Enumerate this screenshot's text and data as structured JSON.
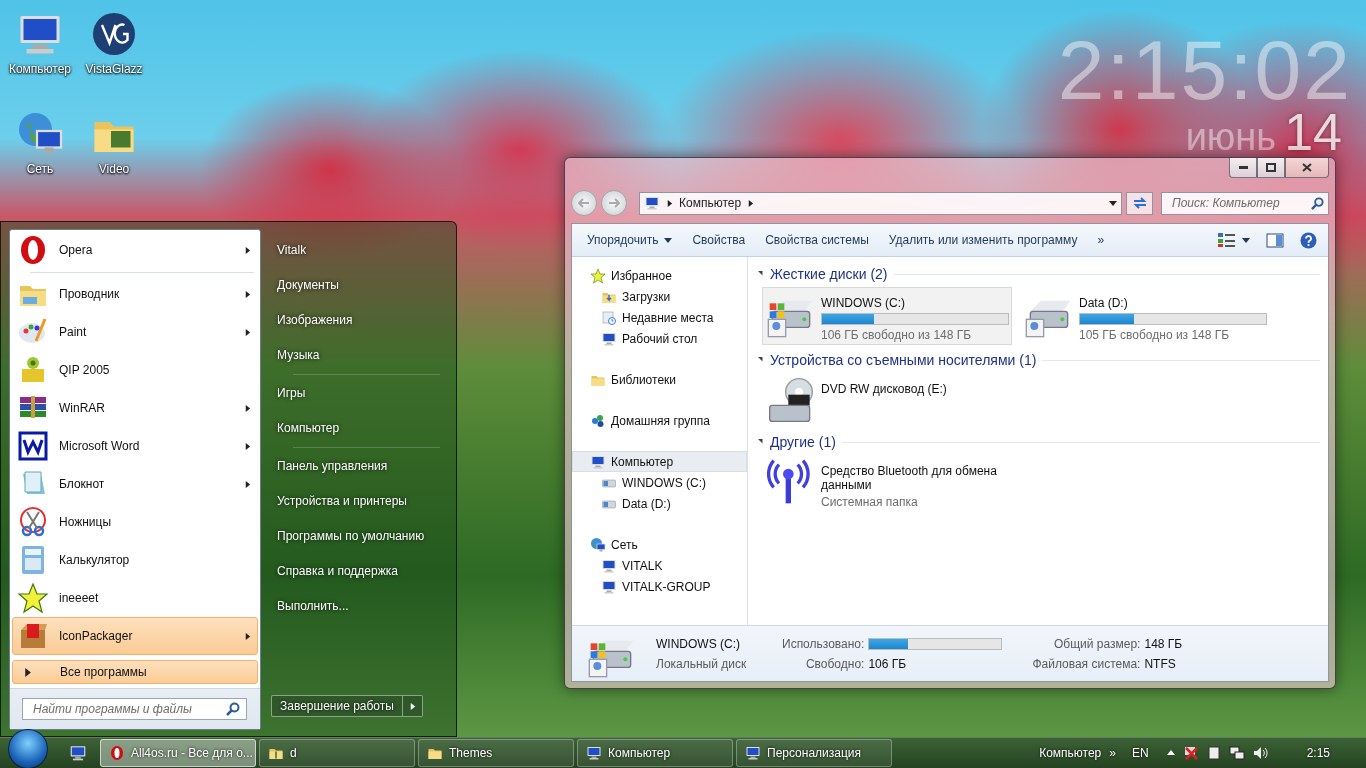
{
  "desktop_icons": [
    {
      "label": "Компьютер",
      "kind": "computer"
    },
    {
      "label": "VistaGlazz",
      "kind": "vg"
    },
    {
      "label": "Сеть",
      "kind": "network"
    },
    {
      "label": "Video",
      "kind": "video"
    }
  ],
  "clock_gadget": {
    "time": "2:15:02",
    "month": "июнь",
    "day": "14"
  },
  "start_menu": {
    "pinned": [
      {
        "label": "Opera",
        "kind": "opera",
        "submenu": true,
        "selected": false
      }
    ],
    "recent": [
      {
        "label": "Проводник",
        "kind": "explorer",
        "submenu": true,
        "selected": false
      },
      {
        "label": "Paint",
        "kind": "paint",
        "submenu": true,
        "selected": false
      },
      {
        "label": "QIP 2005",
        "kind": "qip",
        "submenu": false,
        "selected": false
      },
      {
        "label": "WinRAR",
        "kind": "winrar",
        "submenu": true,
        "selected": false
      },
      {
        "label": "Microsoft Word",
        "kind": "word",
        "submenu": true,
        "selected": false
      },
      {
        "label": "Блокнот",
        "kind": "notepad",
        "submenu": true,
        "selected": false
      },
      {
        "label": "Ножницы",
        "kind": "scissors",
        "submenu": false,
        "selected": false
      },
      {
        "label": "Калькулятор",
        "kind": "calculator",
        "submenu": false,
        "selected": false
      },
      {
        "label": "ineeeet",
        "kind": "star",
        "submenu": false,
        "selected": false
      },
      {
        "label": "IconPackager",
        "kind": "iconpackager",
        "submenu": true,
        "selected": true
      }
    ],
    "all_programs": "Все программы",
    "search_placeholder": "Найти программы и файлы",
    "place_groups": [
      [
        "Vitalk",
        "Документы",
        "Изображения",
        "Музыка"
      ],
      [
        "Игры",
        "Компьютер"
      ],
      [
        "Панель управления",
        "Устройства и принтеры",
        "Программы по умолчанию",
        "Справка и поддержка",
        "Выполнить..."
      ]
    ],
    "shutdown": "Завершение работы"
  },
  "explorer": {
    "path": [
      "Компьютер"
    ],
    "search_placeholder": "Поиск: Компьютер",
    "toolbar": [
      {
        "label": "Упорядочить",
        "dropdown": true
      },
      {
        "label": "Свойства",
        "dropdown": false
      },
      {
        "label": "Свойства системы",
        "dropdown": false
      },
      {
        "label": "Удалить или изменить программу",
        "dropdown": false
      }
    ],
    "toolbar_more": "»",
    "nav": [
      {
        "label": "Избранное",
        "kind": "star",
        "selected": false,
        "children": [
          {
            "label": "Загрузки",
            "kind": "downloads",
            "selected": false
          },
          {
            "label": "Недавние места",
            "kind": "recent",
            "selected": false
          },
          {
            "label": "Рабочий стол",
            "kind": "desktop",
            "selected": false
          }
        ]
      },
      {
        "label": "Библиотеки",
        "kind": "libraries",
        "selected": false
      },
      {
        "label": "Домашняя группа",
        "kind": "homegroup",
        "selected": false
      },
      {
        "label": "Компьютер",
        "kind": "pc",
        "selected": true,
        "children": [
          {
            "label": "WINDOWS (C:)",
            "kind": "smalldrive",
            "selected": false
          },
          {
            "label": "Data (D:)",
            "kind": "smalldrive",
            "selected": false
          }
        ]
      },
      {
        "label": "Сеть",
        "kind": "network",
        "selected": false,
        "children": [
          {
            "label": "VITALK",
            "kind": "pc",
            "selected": false
          },
          {
            "label": "VITALK-GROUP",
            "kind": "pc",
            "selected": false
          }
        ]
      }
    ],
    "groups": [
      {
        "title": "Жесткие диски (2)",
        "items": [
          {
            "kind": "system-drive",
            "name": "WINDOWS (C:)",
            "level": 0.28,
            "info": "106 ГБ свободно из 148 ГБ",
            "selected": true
          },
          {
            "kind": "drive",
            "name": "Data (D:)",
            "level": 0.29,
            "info": "105 ГБ свободно из 148 ГБ",
            "selected": false
          }
        ]
      },
      {
        "title": "Устройства со съемными носителями (1)",
        "items": [
          {
            "kind": "dvd",
            "name": "DVD RW дисковод (E:)",
            "selected": false
          }
        ]
      },
      {
        "title": "Другие (1)",
        "items": [
          {
            "kind": "bluetooth",
            "name": "Средство Bluetooth для обмена данными",
            "info": "Системная папка",
            "selected": false
          }
        ]
      }
    ],
    "details": {
      "name": "WINDOWS (C:)",
      "type": "Локальный диск",
      "columns": [
        [
          {
            "label": "Использовано:",
            "kind": "bar",
            "level": 0.29
          },
          {
            "label": "Свободно:",
            "kind": "text",
            "value": "106 ГБ"
          }
        ],
        [
          {
            "label": "Общий размер:",
            "kind": "text",
            "value": "148 ГБ"
          },
          {
            "label": "Файловая система:",
            "kind": "text",
            "value": "NTFS"
          }
        ]
      ]
    }
  },
  "taskbar": {
    "buttons": [
      {
        "label": "All4os.ru - Все для о...",
        "kind": "opera",
        "selected": true
      },
      {
        "label": "d",
        "kind": "zipfolder",
        "selected": false
      },
      {
        "label": "Themes",
        "kind": "folder",
        "selected": false
      },
      {
        "label": "Компьютер",
        "kind": "pc",
        "selected": false
      },
      {
        "label": "Персонализация",
        "kind": "personalize",
        "selected": false
      }
    ],
    "toolbar_label": "Компьютер",
    "toolbar_more": "»",
    "language": "EN",
    "time": "2:15"
  }
}
